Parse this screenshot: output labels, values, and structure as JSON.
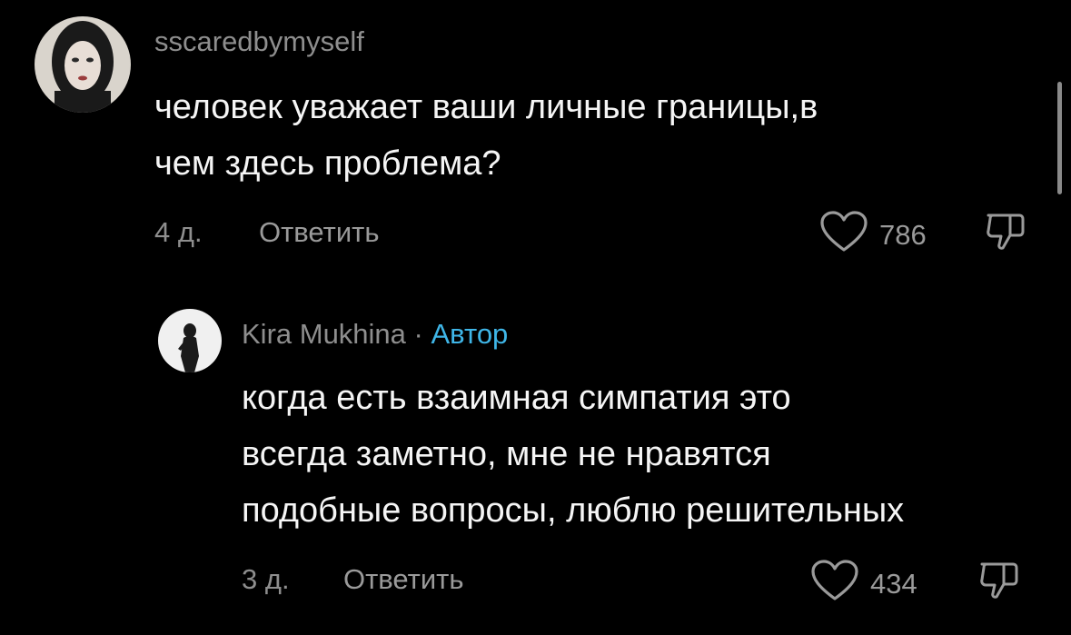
{
  "comments": [
    {
      "username": "sscaredbymyself",
      "text": "человек уважает ваши личные границы,в\nчем здесь проблема?",
      "time": "4 д.",
      "reply_label": "Ответить",
      "likes": "786",
      "icons": {
        "like": "heart-icon",
        "dislike": "thumbs-down-icon"
      }
    }
  ],
  "replies": [
    {
      "username": "Kira Mukhina",
      "separator": "·",
      "badge": "Автор",
      "text": "когда есть взаимная симпатия это\nвсегда заметно, мне не нравятся\nподобные вопросы, люблю решительных",
      "time": "3 д.",
      "reply_label": "Ответить",
      "likes": "434",
      "icons": {
        "like": "heart-icon",
        "dislike": "thumbs-down-icon"
      }
    }
  ],
  "colors": {
    "background": "#000000",
    "text": "#f5f5f5",
    "muted": "#8e8e8e",
    "author_badge": "#3fb6e8"
  }
}
